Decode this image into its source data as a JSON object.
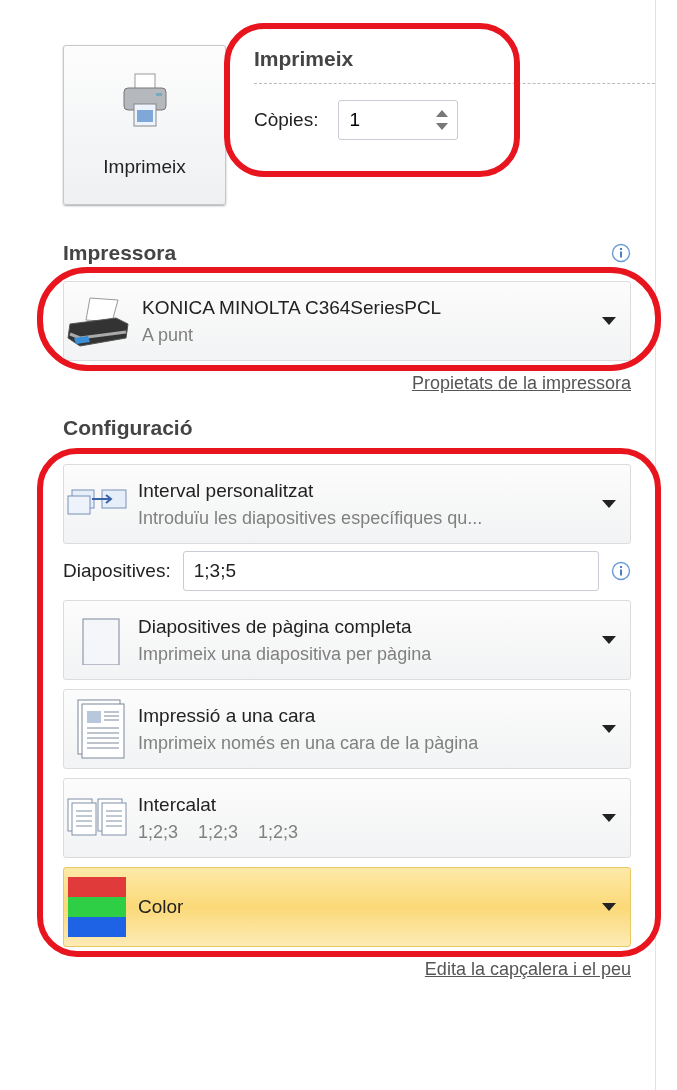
{
  "print": {
    "button_label": "Imprimeix",
    "heading": "Imprimeix",
    "copies_label": "Còpies:",
    "copies_value": "1",
    "highlighted": true
  },
  "printer": {
    "heading": "Impressora",
    "name": "KONICA MINOLTA C364SeriesPCL",
    "status": "A punt",
    "properties_link": "Propietats de la impressora",
    "highlighted": true
  },
  "settings": {
    "heading": "Configuració",
    "highlighted": true,
    "items": [
      {
        "kind": "range",
        "title": "Interval personalitzat",
        "subtitle": "Introduïu les diapositives específiques qu...",
        "highlighted": false
      },
      {
        "kind": "field",
        "label": "Diapositives:",
        "value": "1;3;5"
      },
      {
        "kind": "layout",
        "title": "Diapositives de pàgina completa",
        "subtitle": "Imprimeix una diapositiva per pàgina",
        "highlighted": false
      },
      {
        "kind": "sides",
        "title": "Impressió a una cara",
        "subtitle": "Imprimeix només en una cara de la pàgina",
        "highlighted": false
      },
      {
        "kind": "collate",
        "title": "Intercalat",
        "parts": [
          "1;2;3",
          "1;2;3",
          "1;2;3"
        ],
        "highlighted": false
      },
      {
        "kind": "color",
        "title": "Color",
        "highlighted": true
      }
    ],
    "footer_link": "Edita la capçalera i el peu"
  }
}
